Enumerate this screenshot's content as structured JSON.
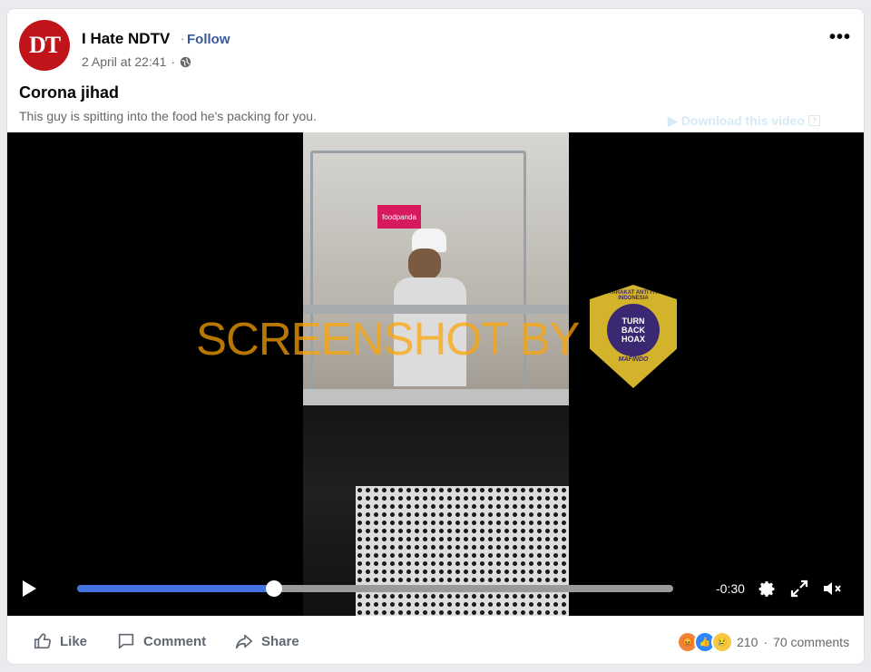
{
  "post": {
    "page_name": "I Hate NDTV",
    "follow_label": "Follow",
    "separator": "·",
    "timestamp": "2 April at 22:41",
    "timestamp_sep": "·",
    "more_label": "•••",
    "title": "Corona jihad",
    "description": "This guy is spitting into the food he's packing for you.",
    "avatar_text": "DT"
  },
  "overlay": {
    "download_label": "Download this video",
    "download_extra": "?",
    "watermark_text": "SCREENSHOT BY",
    "badge_top": "MASYARAKAT ANTI FITNAH INDONESIA",
    "badge_lines": [
      "TURN",
      "BACK",
      "HOAX"
    ],
    "badge_bottom": "MAFINDO",
    "video_tag": "foodpanda"
  },
  "player": {
    "time_remaining": "-0:30",
    "progress": 0.33
  },
  "actions": {
    "like": "Like",
    "comment": "Comment",
    "share": "Share"
  },
  "stats": {
    "reaction_count": "210",
    "dot": "·",
    "comments": "70 comments"
  },
  "colors": {
    "link_blue": "#385898",
    "progress_blue": "#4472e0",
    "watermark_orange": "#ffa500"
  }
}
